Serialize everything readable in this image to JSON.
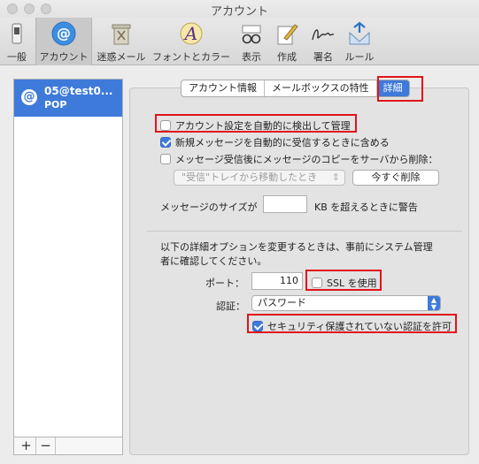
{
  "window": {
    "title": "アカウント"
  },
  "toolbar": {
    "items": [
      {
        "label": "一般",
        "icon": "general-switch-icon"
      },
      {
        "label": "アカウント",
        "icon": "at-sign-icon"
      },
      {
        "label": "迷惑メール",
        "icon": "junk-trash-icon"
      },
      {
        "label": "フォントとカラー",
        "icon": "fonts-colors-icon"
      },
      {
        "label": "表示",
        "icon": "glasses-icon"
      },
      {
        "label": "作成",
        "icon": "compose-icon"
      },
      {
        "label": "署名",
        "icon": "signature-icon"
      },
      {
        "label": "ルール",
        "icon": "rules-icon"
      }
    ]
  },
  "accounts": [
    {
      "name": "05@test0...",
      "type": "POP",
      "badge": "@"
    }
  ],
  "account_list_footer": {
    "add": "+",
    "remove": "−"
  },
  "tabs": [
    "アカウント情報",
    "メールボックスの特性",
    "詳細"
  ],
  "advanced": {
    "auto_detect_label": "アカウント設定を自動的に検出して管理",
    "auto_detect_checked": false,
    "include_auto_receive_label": "新規メッセージを自動的に受信するときに含める",
    "include_auto_receive_checked": true,
    "remove_copy_label": "メッセージ受信後にメッセージのコピーをサーバから削除：",
    "remove_copy_checked": false,
    "remove_timing_value": "\"受信\"トレイから移動したとき",
    "remove_now_button": "今すぐ削除",
    "size_warning_prefix": "メッセージのサイズが",
    "size_warning_value": "",
    "size_warning_suffix": "KB を超えるときに警告",
    "notice_line1": "以下の詳細オプションを変更するときは、事前にシステム管理",
    "notice_line2": "者に確認してください。",
    "port_label": "ポート：",
    "port_value": "110",
    "ssl_label": "SSL を使用",
    "ssl_checked": false,
    "auth_label": "認証：",
    "auth_value": "パスワード",
    "insecure_auth_label": "セキュリティ保護されていない認証を許可",
    "insecure_auth_checked": true
  },
  "colors": {
    "accent": "#3e7ad9",
    "highlight_box": "#e1141b"
  }
}
